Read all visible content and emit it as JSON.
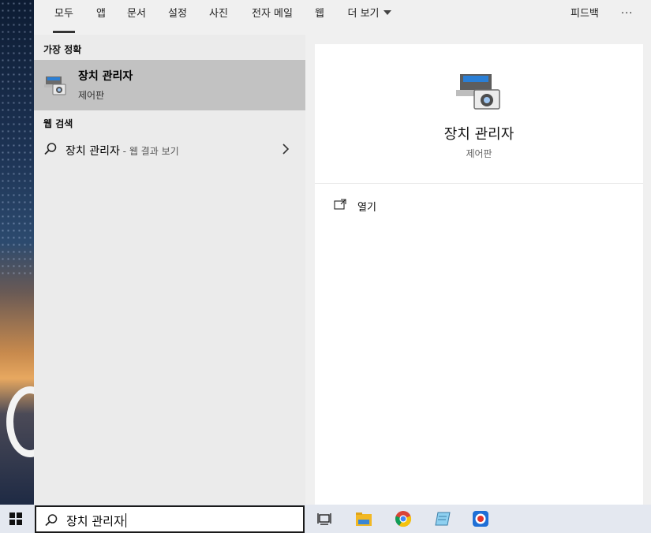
{
  "tabs": [
    {
      "label": "모두",
      "active": true
    },
    {
      "label": "앱"
    },
    {
      "label": "문서"
    },
    {
      "label": "설정"
    },
    {
      "label": "사진"
    },
    {
      "label": "전자 메일"
    },
    {
      "label": "웹"
    },
    {
      "label": "더 보기"
    }
  ],
  "header_right": {
    "feedback": "피드백",
    "more": "···"
  },
  "best_match": {
    "section": "가장 정확",
    "title": "장치 관리자",
    "subtitle": "제어판"
  },
  "web_search": {
    "section": "웹 검색",
    "query": "장치 관리자",
    "hint": " - 웹 결과 보기"
  },
  "preview": {
    "title": "장치 관리자",
    "subtitle": "제어판",
    "actions": [
      {
        "label": "열기",
        "icon": "open-icon"
      }
    ]
  },
  "taskbar": {
    "search_value": "장치 관리자",
    "apps": [
      "task-view-icon",
      "file-explorer-icon",
      "chrome-icon",
      "notepad-icon",
      "record-app-icon"
    ]
  },
  "colors": {
    "selection": "#c2c2c2",
    "panel": "#f0f0f0",
    "taskbar": "#e4e8f0"
  }
}
